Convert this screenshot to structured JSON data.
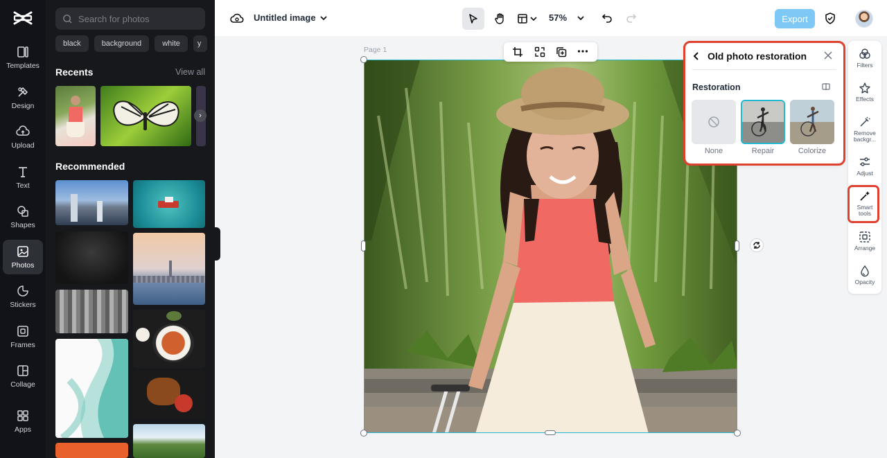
{
  "app": {
    "name": "CapCut",
    "logo_icon": "capcut-logo-icon"
  },
  "nav": {
    "items": [
      {
        "label": "Templates",
        "icon": "templates-icon"
      },
      {
        "label": "Design",
        "icon": "design-icon"
      },
      {
        "label": "Upload",
        "icon": "upload-icon"
      },
      {
        "label": "Text",
        "icon": "text-icon"
      },
      {
        "label": "Shapes",
        "icon": "shapes-icon"
      },
      {
        "label": "Photos",
        "icon": "photos-icon",
        "active": true
      },
      {
        "label": "Stickers",
        "icon": "stickers-icon"
      },
      {
        "label": "Frames",
        "icon": "frames-icon"
      },
      {
        "label": "Collage",
        "icon": "collage-icon"
      },
      {
        "label": "Apps",
        "icon": "apps-icon"
      }
    ]
  },
  "photos_panel": {
    "search_placeholder": "Search for photos",
    "chips": [
      "black",
      "background",
      "white",
      "y"
    ],
    "recents_title": "Recents",
    "view_all": "View all",
    "recommended_title": "Recommended"
  },
  "toolbar": {
    "doc_title": "Untitled image",
    "zoom": "57%",
    "export_label": "Export",
    "accent": "#7dc8f4"
  },
  "canvas": {
    "page_label": "Page 1"
  },
  "restoration_panel": {
    "title": "Old photo restoration",
    "section": "Restoration",
    "options": [
      {
        "label": "None",
        "selected": false
      },
      {
        "label": "Repair",
        "selected": true
      },
      {
        "label": "Colorize",
        "selected": false
      }
    ],
    "highlight_color": "#e0412f"
  },
  "tools": {
    "items": [
      {
        "label": "Filters",
        "icon": "filters-icon"
      },
      {
        "label": "Effects",
        "icon": "effects-icon"
      },
      {
        "label": "Remove backgr...",
        "icon": "remove-background-icon"
      },
      {
        "label": "Adjust",
        "icon": "adjust-icon"
      },
      {
        "label": "Smart tools",
        "icon": "smart-tools-icon",
        "highlighted": true
      },
      {
        "label": "Arrange",
        "icon": "arrange-icon"
      },
      {
        "label": "Opacity",
        "icon": "opacity-icon"
      }
    ]
  }
}
